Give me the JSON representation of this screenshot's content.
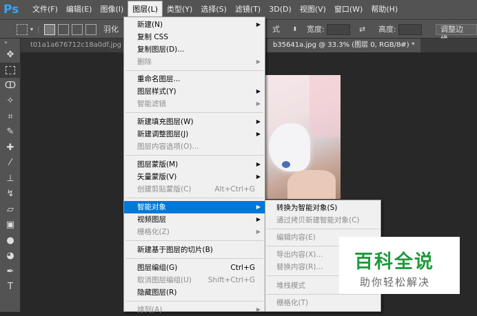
{
  "app": {
    "logo": "Ps"
  },
  "menubar": {
    "items": [
      "文件(F)",
      "编辑(E)",
      "图像(I)",
      "图层(L)",
      "类型(Y)",
      "选择(S)",
      "滤镜(T)",
      "3D(D)",
      "视图(V)",
      "窗口(W)",
      "帮助(H)"
    ],
    "active": "图层(L)"
  },
  "options": {
    "feather_label": "羽化",
    "style_value": "式",
    "width_label": "宽度:",
    "height_label": "高度:",
    "refine_button": "调整边缘..."
  },
  "tabs": [
    {
      "label": "t01a1a676712c18a0df.jpg @"
    },
    {
      "label": "b35641a.jpg @ 33.3% (图层 0, RGB/8#) *"
    },
    {
      "label": "×"
    }
  ],
  "tools": [
    "move-tool",
    "marquee-tool",
    "lasso-tool",
    "quick-select-tool",
    "crop-tool",
    "eyedropper-tool",
    "healing-brush-tool",
    "brush-tool",
    "clone-stamp-tool",
    "history-brush-tool",
    "eraser-tool",
    "gradient-tool",
    "blur-tool",
    "dodge-tool",
    "pen-tool",
    "type-tool"
  ],
  "layer_menu": {
    "items": [
      {
        "label": "新建(N)",
        "disabled": false,
        "submenu": true,
        "shortcut": ""
      },
      {
        "label": "复制 CSS",
        "disabled": false,
        "submenu": false,
        "shortcut": ""
      },
      {
        "label": "复制图层(D)...",
        "disabled": false,
        "submenu": false,
        "shortcut": ""
      },
      {
        "label": "删除",
        "disabled": true,
        "submenu": true,
        "shortcut": ""
      },
      {
        "label": "重命名图层...",
        "disabled": false,
        "submenu": false,
        "shortcut": ""
      },
      {
        "label": "图层样式(Y)",
        "disabled": false,
        "submenu": true,
        "shortcut": ""
      },
      {
        "label": "智能滤镜",
        "disabled": true,
        "submenu": true,
        "shortcut": ""
      },
      {
        "label": "新建填充图层(W)",
        "disabled": false,
        "submenu": true,
        "shortcut": ""
      },
      {
        "label": "新建调整图层(J)",
        "disabled": false,
        "submenu": true,
        "shortcut": ""
      },
      {
        "label": "图层内容选项(O)...",
        "disabled": true,
        "submenu": false,
        "shortcut": ""
      },
      {
        "label": "图层蒙版(M)",
        "disabled": false,
        "submenu": true,
        "shortcut": ""
      },
      {
        "label": "矢量蒙版(V)",
        "disabled": false,
        "submenu": true,
        "shortcut": ""
      },
      {
        "label": "创建剪贴蒙版(C)",
        "disabled": true,
        "submenu": false,
        "shortcut": "Alt+Ctrl+G"
      },
      {
        "label": "智能对象",
        "disabled": false,
        "submenu": true,
        "shortcut": "",
        "highlight": true
      },
      {
        "label": "视频图层",
        "disabled": false,
        "submenu": true,
        "shortcut": ""
      },
      {
        "label": "栅格化(Z)",
        "disabled": true,
        "submenu": true,
        "shortcut": ""
      },
      {
        "label": "新建基于图层的切片(B)",
        "disabled": false,
        "submenu": false,
        "shortcut": ""
      },
      {
        "label": "图层编组(G)",
        "disabled": false,
        "submenu": false,
        "shortcut": "Ctrl+G"
      },
      {
        "label": "取消图层编组(U)",
        "disabled": true,
        "submenu": false,
        "shortcut": "Shift+Ctrl+G"
      },
      {
        "label": "隐藏图层(R)",
        "disabled": false,
        "submenu": false,
        "shortcut": ""
      },
      {
        "label": "排列(A)",
        "disabled": true,
        "submenu": true,
        "shortcut": ""
      }
    ]
  },
  "smart_object_submenu": {
    "items": [
      {
        "label": "转换为智能对象(S)",
        "disabled": false
      },
      {
        "label": "通过拷贝新建智能对象(C)",
        "disabled": true
      },
      {
        "label": "编辑内容(E)",
        "disabled": true
      },
      {
        "label": "导出内容(X)...",
        "disabled": true
      },
      {
        "label": "替换内容(R)...",
        "disabled": true
      },
      {
        "label": "堆栈模式",
        "disabled": true
      },
      {
        "label": "栅格化(T)",
        "disabled": true
      }
    ]
  },
  "watermark": {
    "title": "百科全说",
    "subtitle": "助你轻松解决"
  },
  "colors": {
    "highlight": "#0078d7",
    "menu_bg": "#f0f0f0",
    "ui_bg": "#535353",
    "watermark_green": "#1f9a3d"
  }
}
